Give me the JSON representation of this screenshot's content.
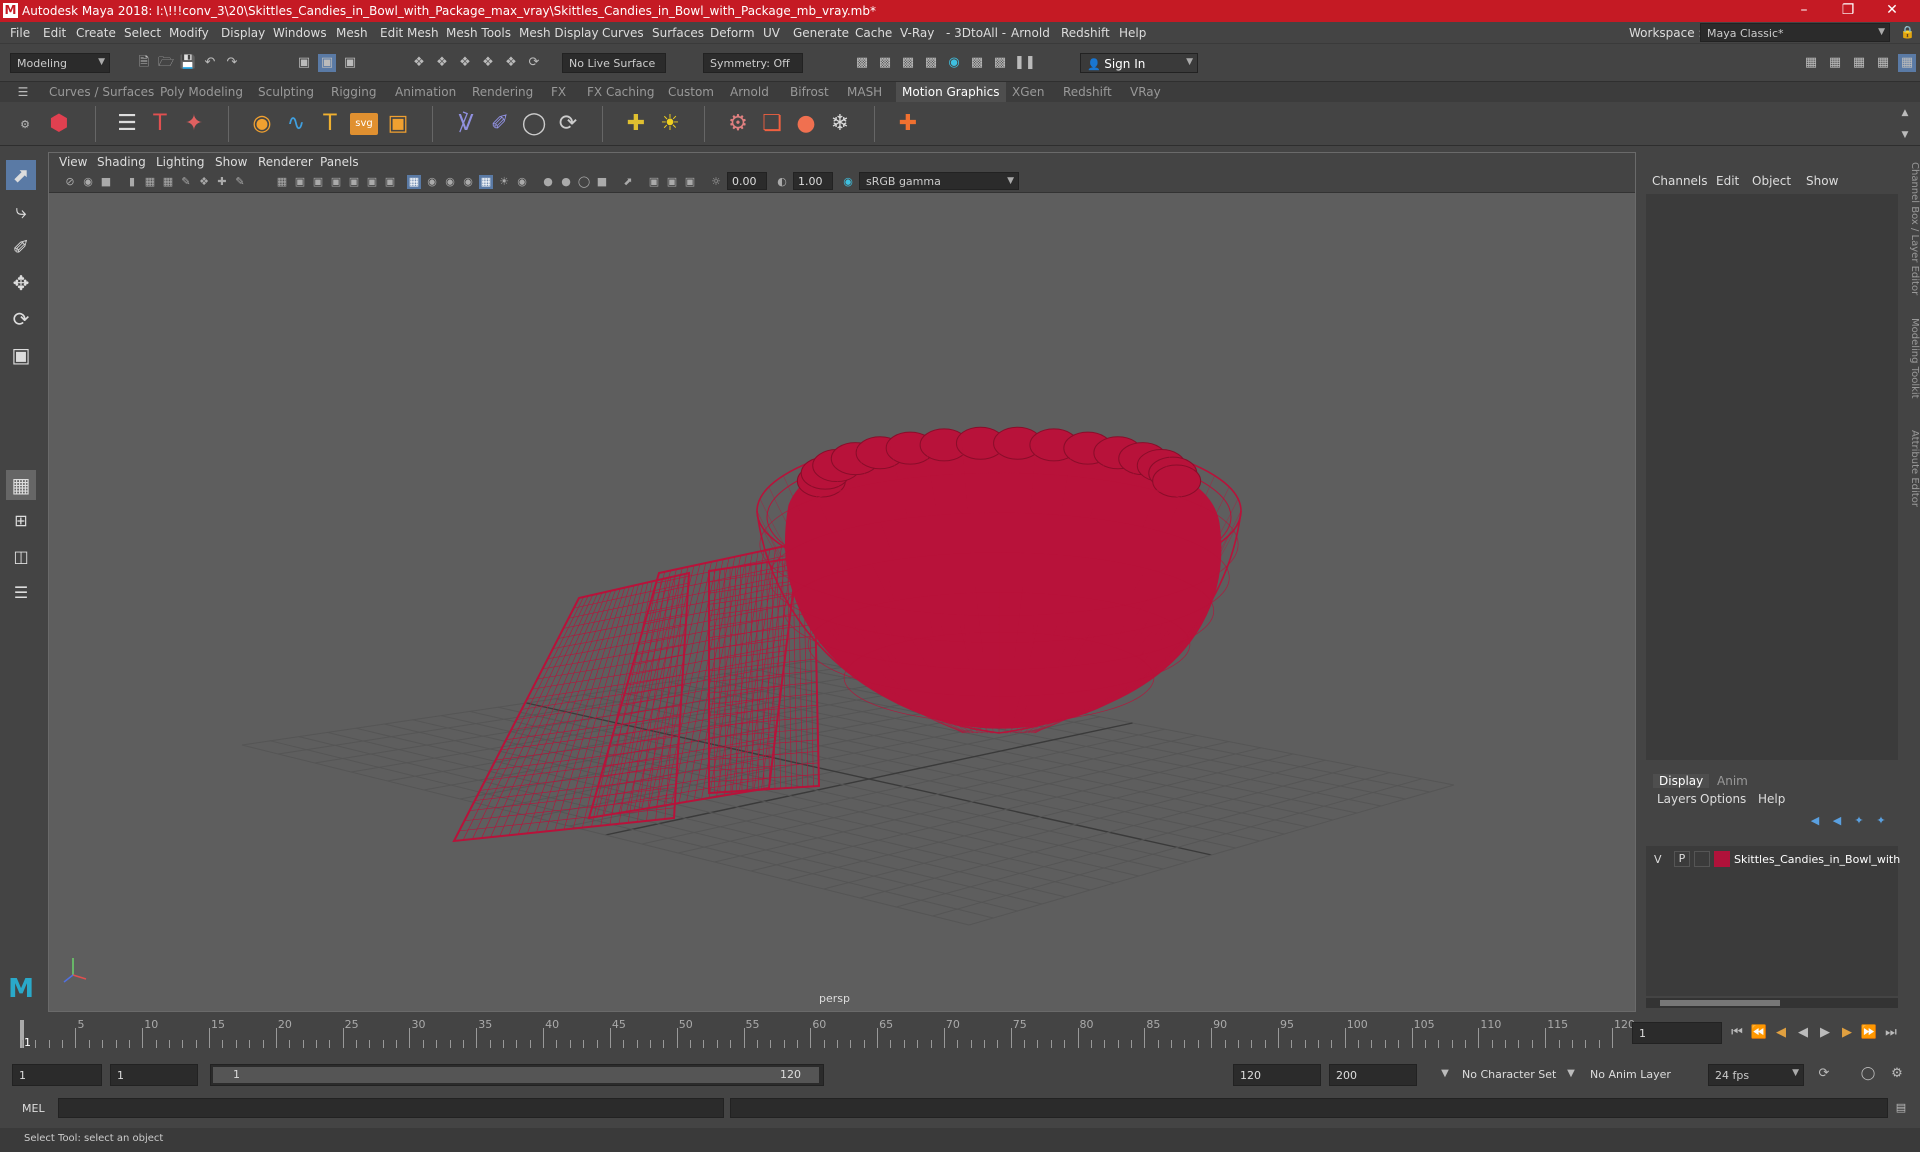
{
  "titlebar": {
    "title": "Autodesk Maya 2018: I:\\!!!conv_3\\20\\Skittles_Candies_in_Bowl_with_Package_max_vray\\Skittles_Candies_in_Bowl_with_Package_mb_vray.mb*",
    "logo": "M"
  },
  "menubar": {
    "items": [
      "File",
      "Edit",
      "Create",
      "Select",
      "Modify",
      "Display",
      "Windows",
      "Mesh",
      "Edit Mesh",
      "Mesh Tools",
      "Mesh Display",
      "Curves",
      "Surfaces",
      "Deform",
      "UV",
      "Generate",
      "Cache",
      "V-Ray",
      "- 3DtoAll -",
      "Arnold",
      "Redshift",
      "Help"
    ],
    "workspace_label": "Workspace :",
    "workspace_value": "Maya Classic*"
  },
  "statusline": {
    "mode": "Modeling",
    "live_surface": "No Live Surface",
    "symmetry": "Symmetry: Off",
    "sign_in": "Sign In"
  },
  "shelf": {
    "tabs": [
      "Curves / Surfaces",
      "Poly Modeling",
      "Sculpting",
      "Rigging",
      "Animation",
      "Rendering",
      "FX",
      "FX Caching",
      "Custom",
      "Arnold",
      "Bifrost",
      "MASH",
      "Motion Graphics",
      "XGen",
      "Redshift",
      "VRay"
    ],
    "active_tab": "Motion Graphics",
    "svg_icon_label": "svg"
  },
  "viewport": {
    "menu": [
      "View",
      "Shading",
      "Lighting",
      "Show",
      "Renderer",
      "Panels"
    ],
    "exposure": "0.00",
    "gamma": "1.00",
    "color_space": "sRGB gamma",
    "camera_label": "persp",
    "wire_color": "#b8123a"
  },
  "channelbox": {
    "menu": [
      "Channels",
      "Edit",
      "Object",
      "Show"
    ]
  },
  "layers": {
    "tabs": [
      "Display",
      "Anim"
    ],
    "active_tab": "Display",
    "menu": [
      "Layers",
      "Options",
      "Help"
    ],
    "rows": [
      {
        "v": "V",
        "p": "P",
        "color": "#b0123a",
        "name": "Skittles_Candies_in_Bowl_with"
      }
    ]
  },
  "side_tabs": [
    "Channel Box / Layer Editor",
    "Modeling Toolkit",
    "Attribute Editor"
  ],
  "timeline": {
    "ticks": [
      "5",
      "10",
      "15",
      "20",
      "25",
      "30",
      "35",
      "40",
      "45",
      "50",
      "55",
      "60",
      "65",
      "70",
      "75",
      "80",
      "85",
      "90",
      "95",
      "100",
      "105",
      "110",
      "115",
      "120"
    ],
    "first_label": "1",
    "current_frame": "1"
  },
  "range": {
    "start": "1",
    "playback_start": "1",
    "slider_start": "1",
    "slider_end": "120",
    "playback_end": "120",
    "end": "200",
    "character_set": "No Character Set",
    "anim_layer": "No Anim Layer",
    "fps": "24 fps"
  },
  "cmdline": {
    "label": "MEL"
  },
  "helpline": {
    "text": "Select Tool: select an object"
  }
}
